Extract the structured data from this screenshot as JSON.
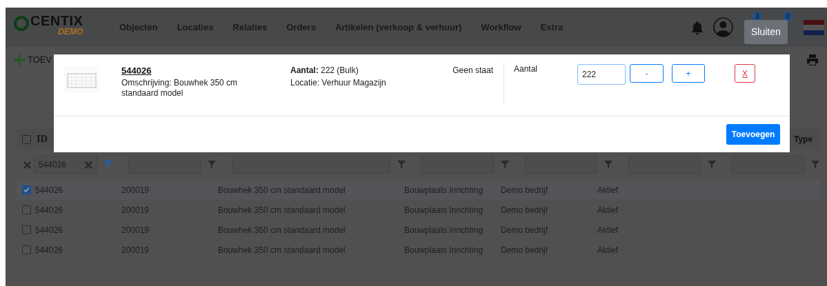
{
  "logo": {
    "name": "CENTIX",
    "sub": "DEMO"
  },
  "menu": [
    "Objecten",
    "Locaties",
    "Relaties",
    "Orders",
    "Artikelen (verkoop & verhuur)",
    "Workflow",
    "Extra"
  ],
  "badges": [
    "3",
    "0"
  ],
  "tooltip": "Sluiten",
  "toolbar": {
    "add_label": "TOEV"
  },
  "table": {
    "select_all": false,
    "id_label": "ID",
    "type_label": "Type",
    "filters": [
      {
        "value": "544026",
        "active": true
      },
      {
        "active": false
      },
      {
        "active": false
      },
      {
        "active": false
      },
      {
        "active": false
      },
      {
        "active": false
      },
      {
        "active": false
      }
    ],
    "rows": [
      {
        "selected": true,
        "cells": [
          "544026",
          "200019",
          "Bouwhek 350 cm standaard model",
          "Bouwplaats Inrichting",
          "Demo bedrijf",
          "Aktief"
        ]
      },
      {
        "selected": false,
        "cells": [
          "544026",
          "200019",
          "Bouwhek 350 cm standaard model",
          "Bouwplaats Inrichting",
          "Demo bedrijf",
          "Aktief"
        ]
      },
      {
        "selected": false,
        "cells": [
          "544026",
          "200019",
          "Bouwhek 350 cm standaard model",
          "Bouwplaats Inrichting",
          "Demo bedrijf",
          "Aktief"
        ]
      },
      {
        "selected": false,
        "cells": [
          "544026",
          "200019",
          "Bouwhek 350 cm standaard model",
          "Bouwplaats Inrichting",
          "Demo bedrijf",
          "Aktief"
        ]
      }
    ]
  },
  "modal": {
    "code": "544026",
    "description": "Omschrijving: Bouwhek 350 cm standaard model",
    "quantity": "**Aantal:** 222 (Bulk)",
    "location": "Locatie: Verhuur Magazijn",
    "state": "Geen staat",
    "amount_label": "Aantal",
    "amount_value": "222",
    "minus": "-",
    "plus": "+",
    "remove": "X",
    "submit": "Toevoegen"
  }
}
